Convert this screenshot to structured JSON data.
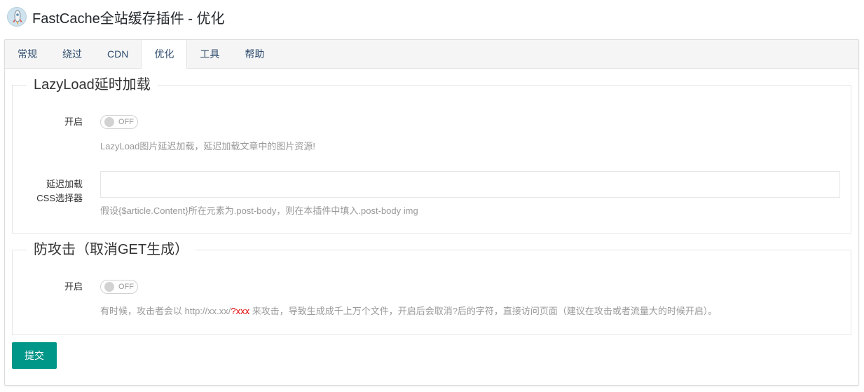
{
  "header": {
    "title": "FastCache全站缓存插件 - 优化",
    "logo_icon": "rocket-icon"
  },
  "tabs": [
    {
      "label": "常规"
    },
    {
      "label": "绕过"
    },
    {
      "label": "CDN"
    },
    {
      "label": "优化",
      "active": true
    },
    {
      "label": "工具"
    },
    {
      "label": "帮助"
    }
  ],
  "lazyload": {
    "legend": "LazyLoad延时加载",
    "enable_label": "开启",
    "enable_state": "OFF",
    "enable_help": "LazyLoad图片延迟加载，延迟加载文章中的图片资源!",
    "selector_label_line1": "延迟加载",
    "selector_label_line2": "CSS选择器",
    "selector_value": "",
    "selector_help": "假设{$article.Content}所在元素为.post-body，则在本插件中填入.post-body img"
  },
  "antiattack": {
    "legend": "防攻击（取消GET生成）",
    "enable_label": "开启",
    "enable_state": "OFF",
    "help_pre": "有时候，攻击者会以 http://xx.xx/",
    "help_highlight": "?xxx",
    "help_post": " 来攻击，导致生成成千上万个文件，开启后会取消?后的字符，直接访问页面（建议在攻击或者流量大的时候开启）。"
  },
  "submit_label": "提交",
  "colors": {
    "primary": "#009688",
    "highlight": "#e00000"
  }
}
